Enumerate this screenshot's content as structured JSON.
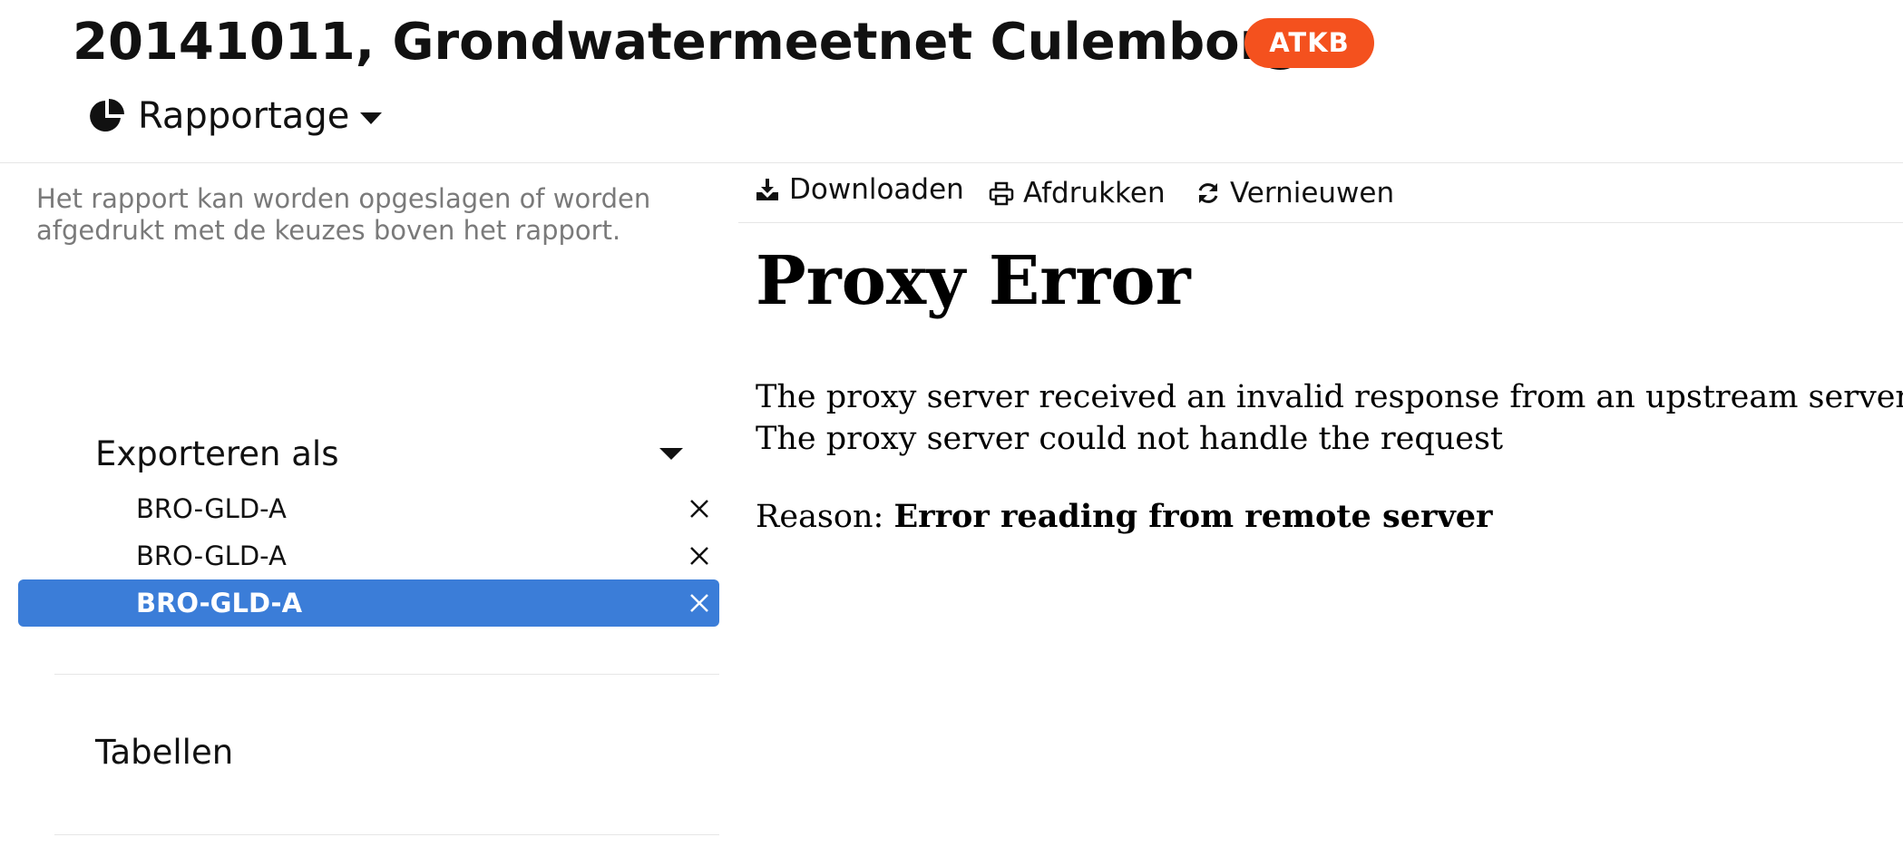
{
  "header": {
    "title": "20141011, Grondwatermeetnet Culemborg",
    "badge": "ATKB",
    "report_menu_label": "Rapportage"
  },
  "sidebar": {
    "hint": "Het rapport kan worden opgeslagen of worden afgedrukt met de keuzes boven het rapport.",
    "export_section_label": "Exporteren als",
    "export_items": [
      {
        "label": "BRO-GLD-A",
        "selected": false
      },
      {
        "label": "BRO-GLD-A",
        "selected": false
      },
      {
        "label": "BRO-GLD-A",
        "selected": true
      }
    ],
    "tables_section_label": "Tabellen"
  },
  "toolbar": {
    "download_label": "Downloaden",
    "print_label": "Afdrukken",
    "refresh_label": "Vernieuwen"
  },
  "error": {
    "title": "Proxy Error",
    "line1": "The proxy server received an invalid response from an upstream server.",
    "line2": "The proxy server could not handle the request",
    "reason_label": "Reason:",
    "reason_text": "Error reading from remote server"
  },
  "colors": {
    "badge": "#f4511e",
    "selected_item": "#3b7dd8"
  },
  "icons": {
    "report_menu": "pie-chart-icon",
    "download": "download-icon",
    "print": "print-icon",
    "refresh": "refresh-icon",
    "remove": "close-icon"
  }
}
